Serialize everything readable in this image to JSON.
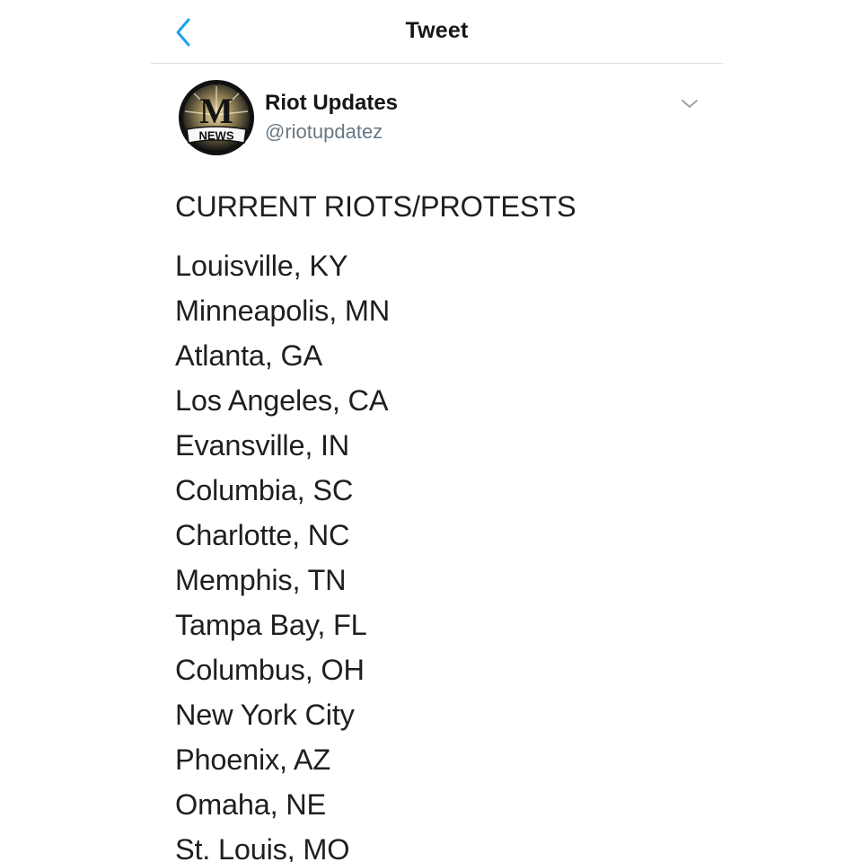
{
  "nav": {
    "title": "Tweet",
    "back_icon": "chevron-left-icon",
    "accent_color": "#1da1f2"
  },
  "tweet": {
    "author": {
      "name": "Riot Updates",
      "handle": "@riotupdatez",
      "avatar": {
        "letter": "M",
        "banner": "NEWS"
      }
    },
    "more_icon": "chevron-down-icon",
    "heading": "CURRENT RIOTS/PROTESTS",
    "locations": [
      "Louisville, KY",
      "Minneapolis, MN",
      "Atlanta, GA",
      "Los Angeles, CA",
      "Evansville, IN",
      "Columbia, SC",
      "Charlotte, NC",
      "Memphis, TN",
      "Tampa Bay, FL",
      "Columbus, OH",
      "New York City",
      "Phoenix, AZ",
      "Omaha, NE",
      "St. Louis, MO"
    ]
  }
}
